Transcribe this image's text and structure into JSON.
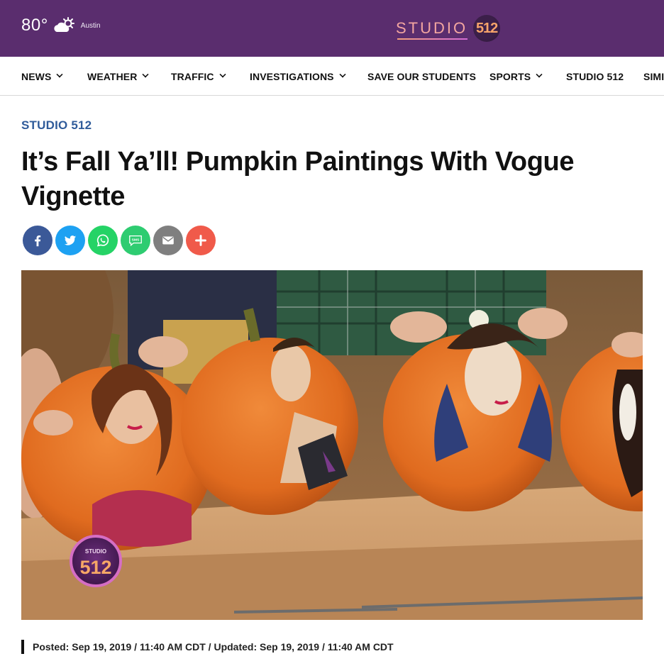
{
  "header": {
    "temperature": "80°",
    "weather_icon": "partly-sunny-icon",
    "city": "Austin",
    "logo_text": "STUDIO",
    "logo_number": "512",
    "colors": {
      "bar": "#5a2d6e",
      "logo_text": "#f3a6a0",
      "logo_number": "#f6a36a"
    }
  },
  "nav": {
    "items": [
      {
        "label": "NEWS",
        "has_dropdown": true
      },
      {
        "label": "WEATHER",
        "has_dropdown": true
      },
      {
        "label": "TRAFFIC",
        "has_dropdown": true
      },
      {
        "label": "INVESTIGATIONS",
        "has_dropdown": true
      },
      {
        "label": "SAVE OUR STUDENTS",
        "has_dropdown": false
      },
      {
        "label": "SPORTS",
        "has_dropdown": true
      },
      {
        "label": "STUDIO 512",
        "has_dropdown": false
      },
      {
        "label": "SIMI",
        "has_dropdown": false
      }
    ]
  },
  "article": {
    "section": "STUDIO 512",
    "title": "It’s Fall Ya’ll! Pumpkin Paintings With Vogue Vignette",
    "share": [
      {
        "name": "facebook",
        "icon": "facebook-icon",
        "color": "#3b5998"
      },
      {
        "name": "twitter",
        "icon": "twitter-icon",
        "color": "#1da1f2"
      },
      {
        "name": "whatsapp",
        "icon": "whatsapp-icon",
        "color": "#25d366"
      },
      {
        "name": "sms",
        "icon": "sms-icon",
        "color": "#2ecc71",
        "label": "SMS"
      },
      {
        "name": "email",
        "icon": "email-icon",
        "color": "#7f7f7f"
      },
      {
        "name": "more",
        "icon": "plus-icon",
        "color": "#f05a4a"
      }
    ],
    "hero_watermark_top": "STUDIO",
    "hero_watermark_number": "512",
    "posted": "Posted: Sep 19, 2019 / 11:40 AM CDT / Updated: Sep 19, 2019 / 11:40 AM CDT"
  }
}
